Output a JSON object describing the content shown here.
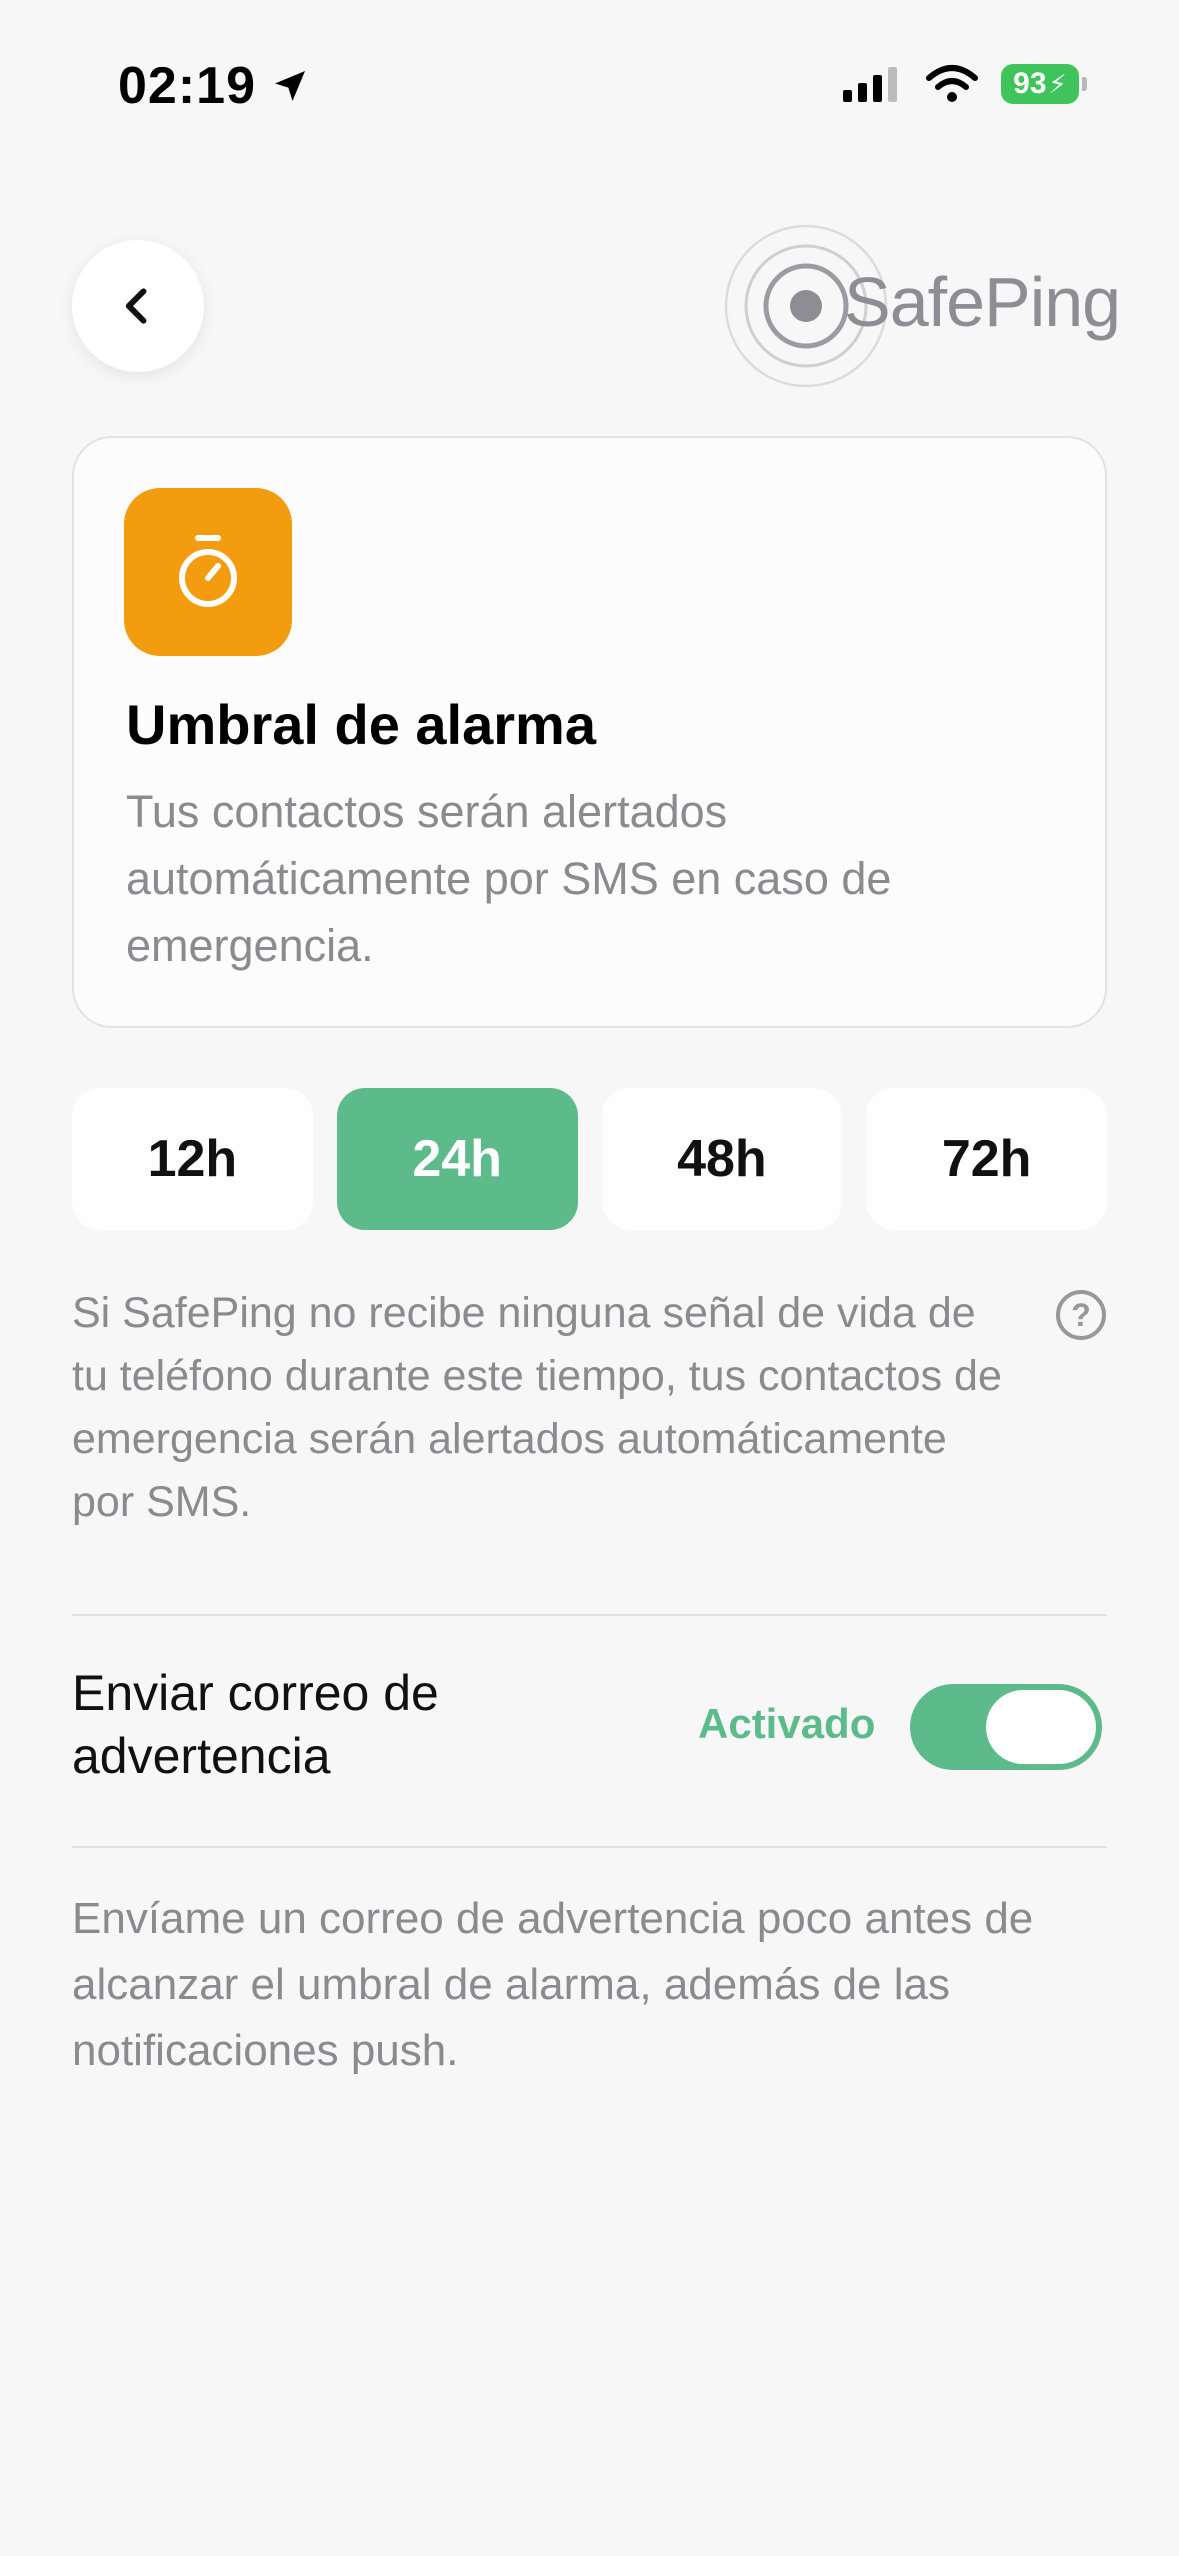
{
  "status_bar": {
    "time": "02:19",
    "battery": "93"
  },
  "header": {
    "logo_text": "SafePing"
  },
  "card": {
    "title": "Umbral de alarma",
    "description": "Tus contactos serán alertados automáticamente por SMS en caso de emergencia.",
    "icon_color": "#f39c10"
  },
  "threshold": {
    "options": [
      "12h",
      "24h",
      "48h",
      "72h"
    ],
    "selected": "24h",
    "info": "Si SafePing no recibe ninguna señal de vida de tu teléfono durante este tiempo, tus contactos de emergencia serán alertados automáticamente por SMS."
  },
  "warning_email": {
    "label": "Enviar correo de advertencia",
    "state_label": "Activado",
    "enabled": true,
    "description": "Envíame un correo de advertencia poco antes de alcanzar el umbral de alarma, además de las notificaciones push."
  },
  "colors": {
    "accent": "#5dbb8b",
    "icon_orange": "#f39c10",
    "secondary_text": "#8a8a8f"
  }
}
